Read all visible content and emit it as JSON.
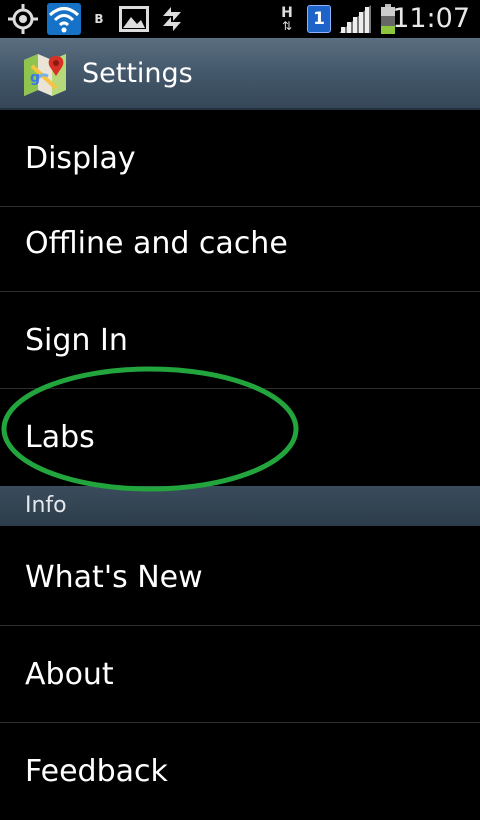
{
  "status_bar": {
    "time": "11:07",
    "b_indicator": "B",
    "h_indicator": "H",
    "notification_count": "1",
    "icons": [
      "gps-icon",
      "wifi-icon",
      "b-indicator-icon",
      "image-icon",
      "sync-icon",
      "h-data-icon",
      "notification-badge-icon",
      "signal-icon",
      "battery-icon"
    ]
  },
  "action_bar": {
    "title": "Settings",
    "app_icon": "maps-app-icon"
  },
  "items": [
    {
      "label": "Display"
    },
    {
      "label": "Offline and cache"
    },
    {
      "label": "Sign In"
    },
    {
      "label": "Labs"
    }
  ],
  "section": {
    "label": "Info"
  },
  "info_items": [
    {
      "label": "What's New"
    },
    {
      "label": "About"
    },
    {
      "label": "Feedback"
    }
  ],
  "colors": {
    "background": "#000000",
    "action_bar": "#44586b",
    "section_header": "#34475a",
    "highlight_ellipse": "#22a53c",
    "divider": "#2c2c2c"
  }
}
